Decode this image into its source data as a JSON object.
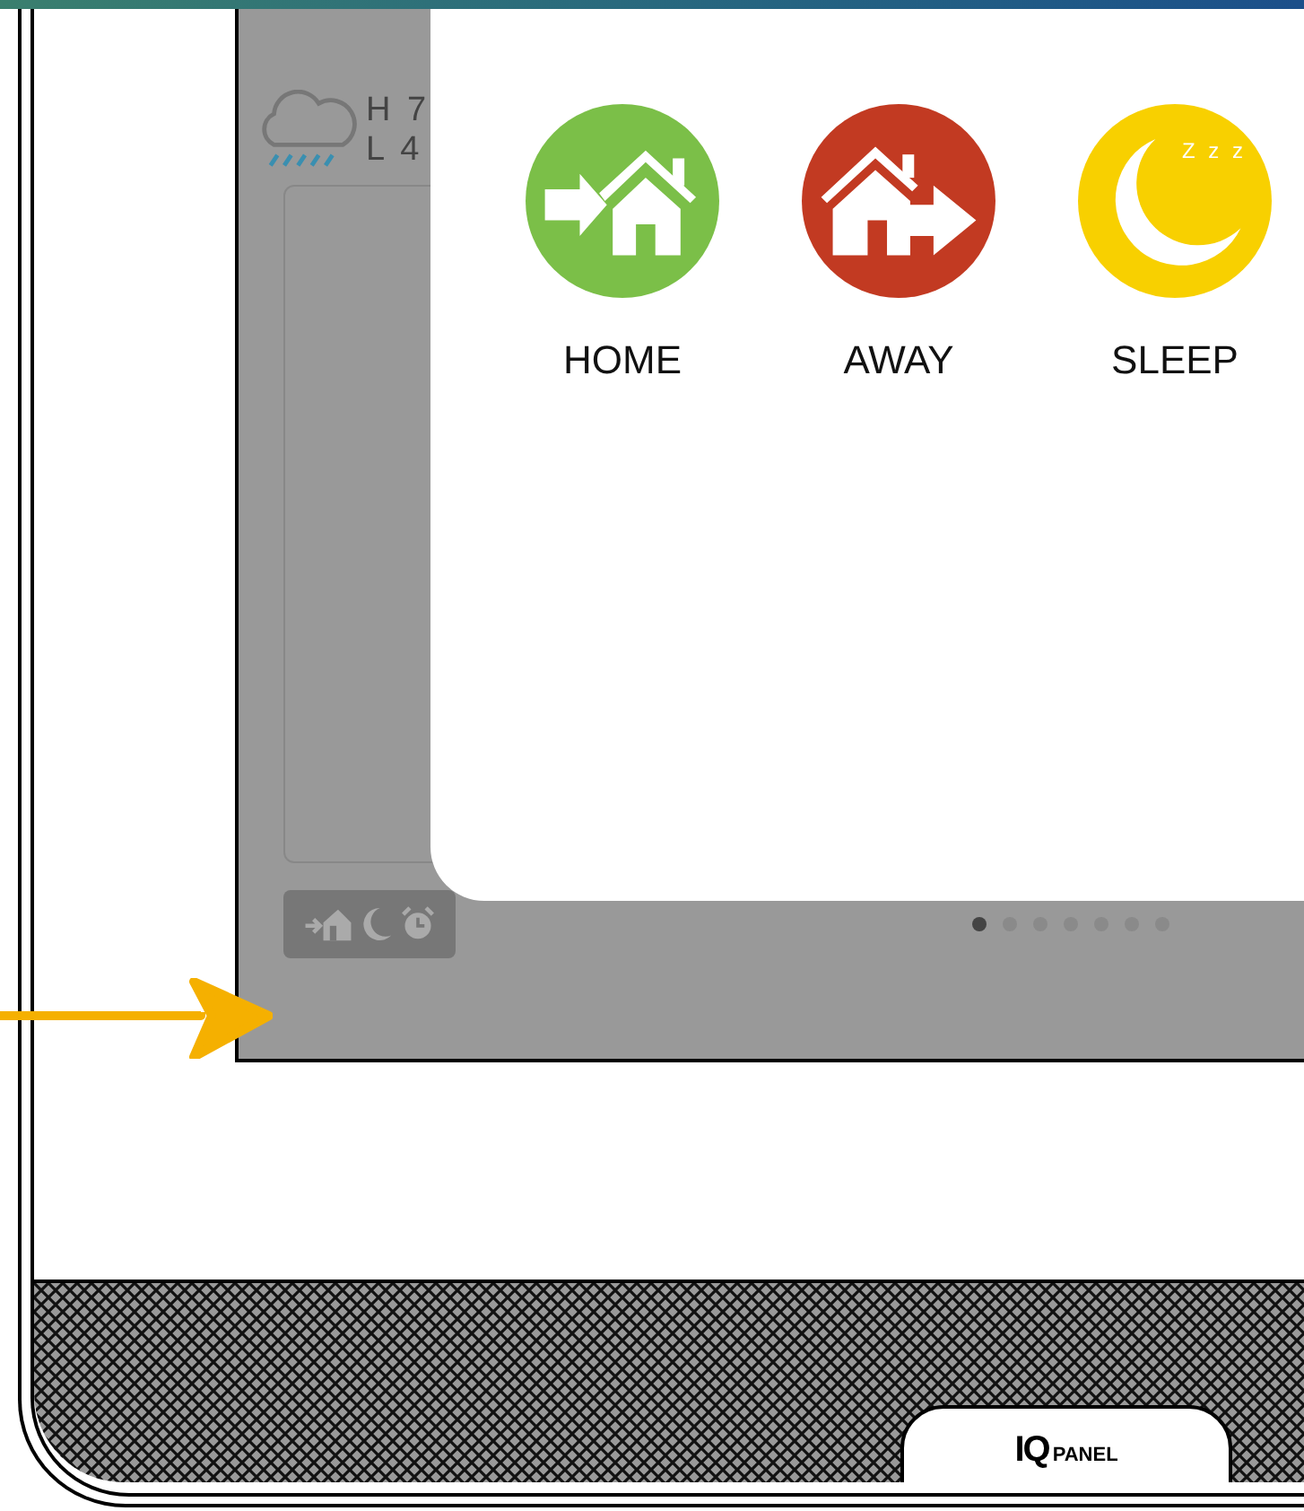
{
  "weather": {
    "high": "H 7",
    "low": "L 4"
  },
  "modes": [
    {
      "kind": "home",
      "label": "HOME",
      "color": "#7bbf48"
    },
    {
      "kind": "away",
      "label": "AWAY",
      "color": "#c23a22"
    },
    {
      "kind": "sleep",
      "label": "SLEEP",
      "color": "#f8d000",
      "icon_text": "Z z z"
    }
  ],
  "page_dots": [
    {
      "selected": true
    },
    {
      "selected": false
    },
    {
      "selected": false
    },
    {
      "selected": false
    },
    {
      "selected": false
    },
    {
      "selected": false
    },
    {
      "selected": false
    }
  ],
  "logo": {
    "mark": "IQ",
    "word": "PANEL"
  }
}
